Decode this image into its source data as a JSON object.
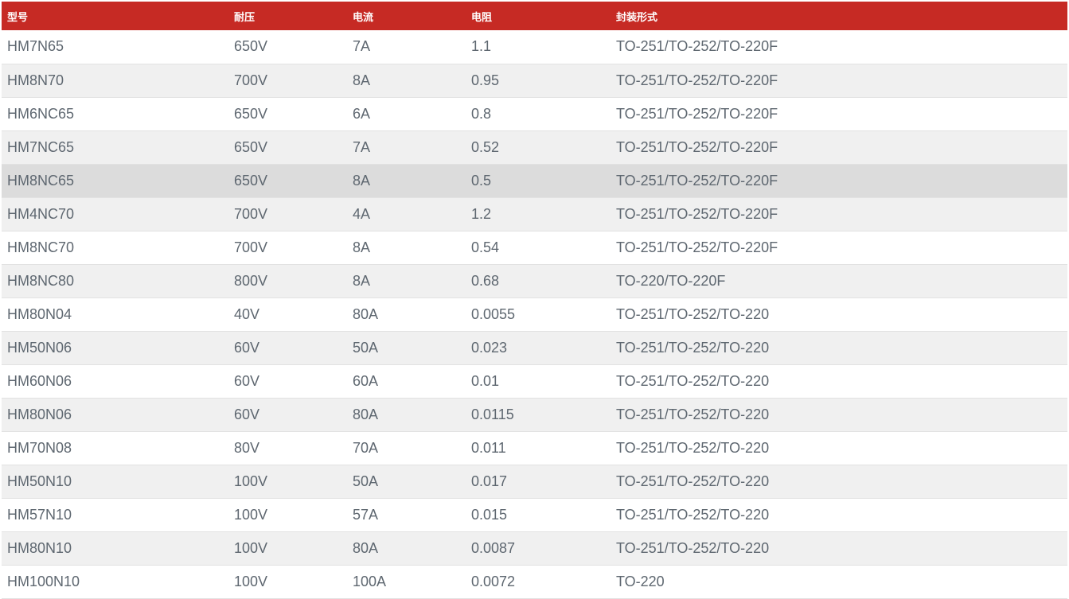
{
  "table": {
    "headers": [
      "型号",
      "耐压",
      "电流",
      "电阻",
      "封装形式"
    ],
    "rows": [
      [
        "HM7N65",
        "650V",
        "7A",
        "1.1",
        "TO-251/TO-252/TO-220F"
      ],
      [
        "HM8N70",
        "700V",
        "8A",
        "0.95",
        "TO-251/TO-252/TO-220F"
      ],
      [
        "HM6NC65",
        "650V",
        "6A",
        "0.8",
        "TO-251/TO-252/TO-220F"
      ],
      [
        "HM7NC65",
        "650V",
        "7A",
        "0.52",
        "TO-251/TO-252/TO-220F"
      ],
      [
        "HM8NC65",
        "650V",
        "8A",
        "0.5",
        "TO-251/TO-252/TO-220F"
      ],
      [
        "HM4NC70",
        "700V",
        "4A",
        "1.2",
        "TO-251/TO-252/TO-220F"
      ],
      [
        "HM8NC70",
        "700V",
        "8A",
        "0.54",
        "TO-251/TO-252/TO-220F"
      ],
      [
        "HM8NC80",
        "800V",
        "8A",
        "0.68",
        "TO-220/TO-220F"
      ],
      [
        "HM80N04",
        "40V",
        "80A",
        "0.0055",
        "TO-251/TO-252/TO-220"
      ],
      [
        "HM50N06",
        "60V",
        "50A",
        "0.023",
        "TO-251/TO-252/TO-220"
      ],
      [
        "HM60N06",
        "60V",
        "60A",
        "0.01",
        "TO-251/TO-252/TO-220"
      ],
      [
        "HM80N06",
        "60V",
        "80A",
        "0.0115",
        "TO-251/TO-252/TO-220"
      ],
      [
        "HM70N08",
        "80V",
        "70A",
        "0.011",
        "TO-251/TO-252/TO-220"
      ],
      [
        "HM50N10",
        "100V",
        "50A",
        "0.017",
        "TO-251/TO-252/TO-220"
      ],
      [
        "HM57N10",
        "100V",
        "57A",
        "0.015",
        "TO-251/TO-252/TO-220"
      ],
      [
        "HM80N10",
        "100V",
        "80A",
        "0.0087",
        "TO-251/TO-252/TO-220"
      ],
      [
        "HM100N10",
        "100V",
        "100A",
        "0.0072",
        "TO-220"
      ]
    ],
    "hovered_row": 4
  },
  "colors": {
    "header_bg": "#c62a24",
    "header_text": "#ffffff",
    "cell_text": "#5e6770",
    "row_alt_bg": "#f0f0f0",
    "row_hover_bg": "#dcdcdc"
  }
}
